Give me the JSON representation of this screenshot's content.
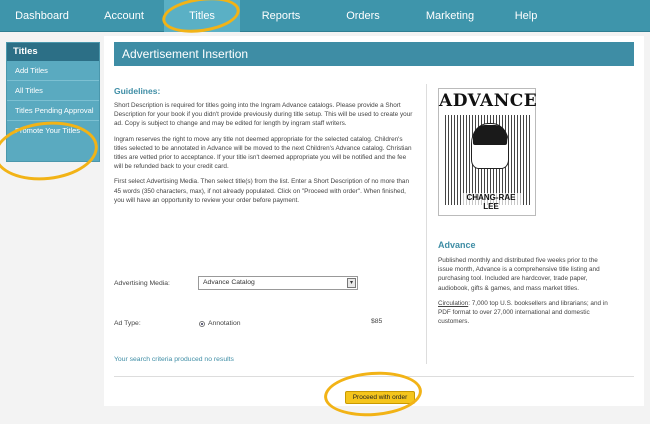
{
  "nav": [
    "Dashboard",
    "Account",
    "Titles",
    "Reports",
    "Orders",
    "Marketing",
    "Help"
  ],
  "sidebar": {
    "title": "Titles",
    "items": [
      "Add Titles",
      "All Titles",
      "Titles Pending Approval",
      "Promote Your Titles"
    ]
  },
  "page": {
    "title": "Advertisement Insertion",
    "guidelines_heading": "Guidelines:",
    "p1": "Short Description is required for titles going into the Ingram Advance catalogs. Please provide a Short Description for your book if you didn't provide previously during title setup. This will be used to create your ad. Copy is subject to change and may be edited for length by ingram staff writers.",
    "p2": "Ingram reserves the right to move any title not deemed appropriate for the selected catalog. Children's titles selected to be annotated in Advance will be moved to the next Children's Advance catalog. Christian titles are vetted prior to acceptance. If your title isn't deemed appropriate you will be notified and the fee will be refunded back to your credit card.",
    "p3": "First select Advertising Media. Then select title(s) from the list. Enter a Short Description of no more than 45 words (350 characters, max), if not already populated. Click on \"Proceed with order\". When finished, you will have an opportunity to review your order before payment."
  },
  "form": {
    "media_label": "Advertising Media:",
    "media_value": "Advance Catalog",
    "adtype_label": "Ad Type:",
    "adtype_option": "Annotation",
    "price": "$85",
    "no_results": "Your search criteria produced no results",
    "proceed": "Proceed with order"
  },
  "cover": {
    "title": "ADVANCE",
    "author": "CHANG-RAE LEE"
  },
  "side": {
    "heading": "Advance",
    "p1": "Published monthly and distributed five weeks prior to the issue month, Advance is a comprehensive title listing and purchasing tool. Included are hardcover, trade paper, audiobook, gifts & games, and mass market titles.",
    "circ_label": "Circulation",
    "circ_text": ": 7,000 top U.S. booksellers and librarians; and in PDF format to over 27,000 international and domestic customers."
  },
  "colors": {
    "nav": "#3e95ab",
    "accent": "#3e8da5",
    "highlight": "#f2b316",
    "button": "#f5c51c"
  }
}
